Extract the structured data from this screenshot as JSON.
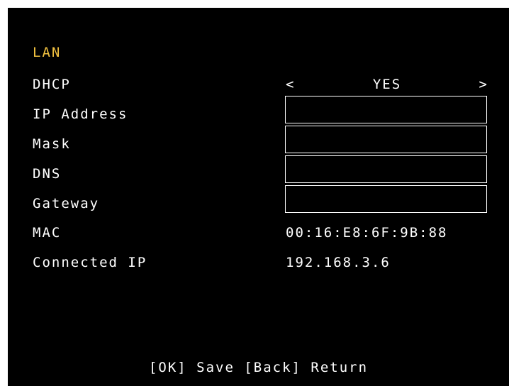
{
  "section_title": "LAN",
  "dhcp": {
    "label": "DHCP",
    "prev": "<",
    "value": "YES",
    "next": ">"
  },
  "ip_address": {
    "label": "IP Address",
    "value": ""
  },
  "mask": {
    "label": "Mask",
    "value": ""
  },
  "dns": {
    "label": "DNS",
    "value": ""
  },
  "gateway": {
    "label": "Gateway",
    "value": ""
  },
  "mac": {
    "label": "MAC",
    "value": "00:16:E8:6F:9B:88"
  },
  "connected_ip": {
    "label": "Connected IP",
    "value": "192.168.3.6"
  },
  "footer": {
    "hint": "[OK] Save [Back] Return"
  },
  "colors": {
    "background": "#000000",
    "text": "#ffffff",
    "highlight": "#f0c040"
  }
}
